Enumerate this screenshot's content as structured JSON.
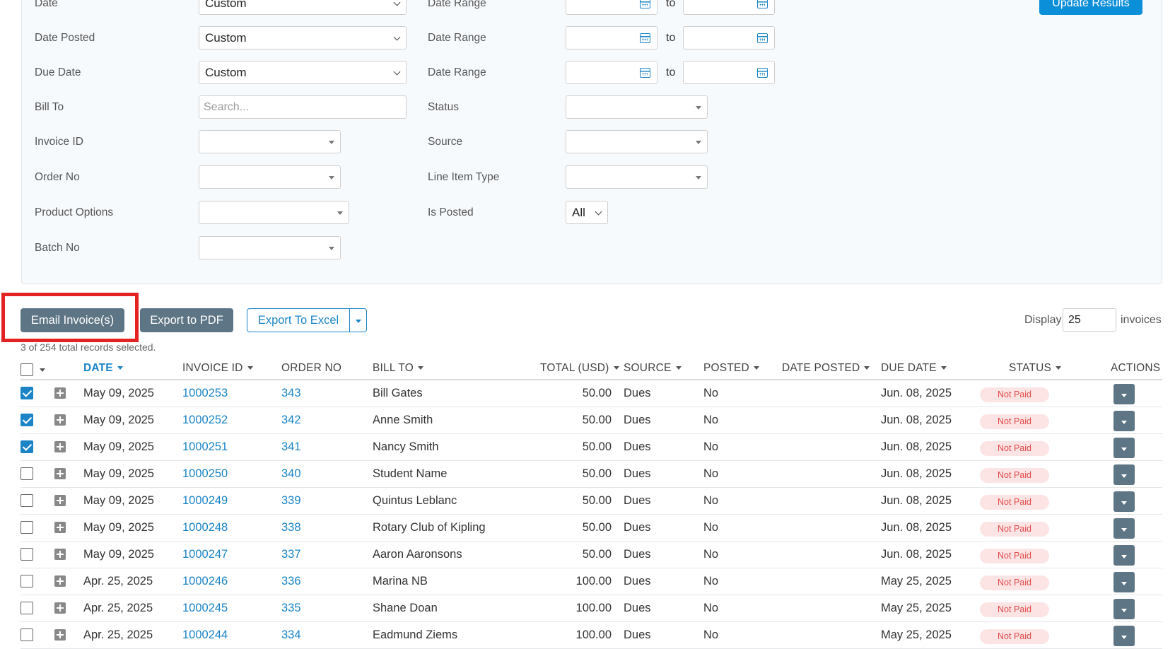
{
  "filters": {
    "date_label": "Date",
    "date_value": "Custom",
    "date_range_label": "Date Range",
    "to_text": "to",
    "date_posted_label": "Date Posted",
    "date_posted_value": "Custom",
    "date_posted_range_label": "Date Range",
    "due_date_label": "Due Date",
    "due_date_value": "Custom",
    "due_date_range_label": "Date Range",
    "bill_to_label": "Bill To",
    "bill_to_placeholder": "Search...",
    "status_label": "Status",
    "invoice_id_label": "Invoice ID",
    "source_label": "Source",
    "order_no_label": "Order No",
    "line_item_type_label": "Line Item Type",
    "product_options_label": "Product Options",
    "is_posted_label": "Is Posted",
    "is_posted_value": "All",
    "batch_no_label": "Batch No",
    "update_button": "Update Results"
  },
  "toolbar": {
    "email_invoices": "Email Invoice(s)",
    "export_pdf": "Export to PDF",
    "export_excel": "Export To Excel",
    "display_label": "Display",
    "display_value": "25",
    "invoices_label": "invoices",
    "records_note": "3 of 254 total records selected."
  },
  "table": {
    "headers": {
      "date": "DATE",
      "invoice_id": "INVOICE ID",
      "order_no": "ORDER NO",
      "bill_to": "BILL TO",
      "total": "TOTAL (USD)",
      "source": "SOURCE",
      "posted": "POSTED",
      "date_posted": "DATE POSTED",
      "due_date": "DUE DATE",
      "status": "STATUS",
      "actions": "ACTIONS"
    },
    "rows": [
      {
        "checked": true,
        "date": "May 09, 2025",
        "invoice_id": "1000253",
        "order_no": "343",
        "bill_to": "Bill Gates",
        "total": "50.00",
        "source": "Dues",
        "posted": "No",
        "due_date": "Jun. 08, 2025",
        "status": "Not Paid"
      },
      {
        "checked": true,
        "date": "May 09, 2025",
        "invoice_id": "1000252",
        "order_no": "342",
        "bill_to": "Anne Smith",
        "total": "50.00",
        "source": "Dues",
        "posted": "No",
        "due_date": "Jun. 08, 2025",
        "status": "Not Paid"
      },
      {
        "checked": true,
        "date": "May 09, 2025",
        "invoice_id": "1000251",
        "order_no": "341",
        "bill_to": "Nancy Smith",
        "total": "50.00",
        "source": "Dues",
        "posted": "No",
        "due_date": "Jun. 08, 2025",
        "status": "Not Paid"
      },
      {
        "checked": false,
        "date": "May 09, 2025",
        "invoice_id": "1000250",
        "order_no": "340",
        "bill_to": "Student Name",
        "total": "50.00",
        "source": "Dues",
        "posted": "No",
        "due_date": "Jun. 08, 2025",
        "status": "Not Paid"
      },
      {
        "checked": false,
        "date": "May 09, 2025",
        "invoice_id": "1000249",
        "order_no": "339",
        "bill_to": "Quintus Leblanc",
        "total": "50.00",
        "source": "Dues",
        "posted": "No",
        "due_date": "Jun. 08, 2025",
        "status": "Not Paid"
      },
      {
        "checked": false,
        "date": "May 09, 2025",
        "invoice_id": "1000248",
        "order_no": "338",
        "bill_to": "Rotary Club of Kipling",
        "total": "50.00",
        "source": "Dues",
        "posted": "No",
        "due_date": "Jun. 08, 2025",
        "status": "Not Paid"
      },
      {
        "checked": false,
        "date": "May 09, 2025",
        "invoice_id": "1000247",
        "order_no": "337",
        "bill_to": "Aaron Aaronsons",
        "total": "50.00",
        "source": "Dues",
        "posted": "No",
        "due_date": "Jun. 08, 2025",
        "status": "Not Paid"
      },
      {
        "checked": false,
        "date": "Apr. 25, 2025",
        "invoice_id": "1000246",
        "order_no": "336",
        "bill_to": "Marina NB",
        "total": "100.00",
        "source": "Dues",
        "posted": "No",
        "due_date": "May 25, 2025",
        "status": "Not Paid"
      },
      {
        "checked": false,
        "date": "Apr. 25, 2025",
        "invoice_id": "1000245",
        "order_no": "335",
        "bill_to": "Shane Doan",
        "total": "100.00",
        "source": "Dues",
        "posted": "No",
        "due_date": "May 25, 2025",
        "status": "Not Paid"
      },
      {
        "checked": false,
        "date": "Apr. 25, 2025",
        "invoice_id": "1000244",
        "order_no": "334",
        "bill_to": "Eadmund Ziems",
        "total": "100.00",
        "source": "Dues",
        "posted": "No",
        "due_date": "May 25, 2025",
        "status": "Not Paid"
      }
    ]
  },
  "colors": {
    "accent": "#1a84c7",
    "button_dark": "#5e7585",
    "highlight": "#e42222",
    "badge_bg": "#fde4e4",
    "badge_text": "#e34a4a"
  }
}
